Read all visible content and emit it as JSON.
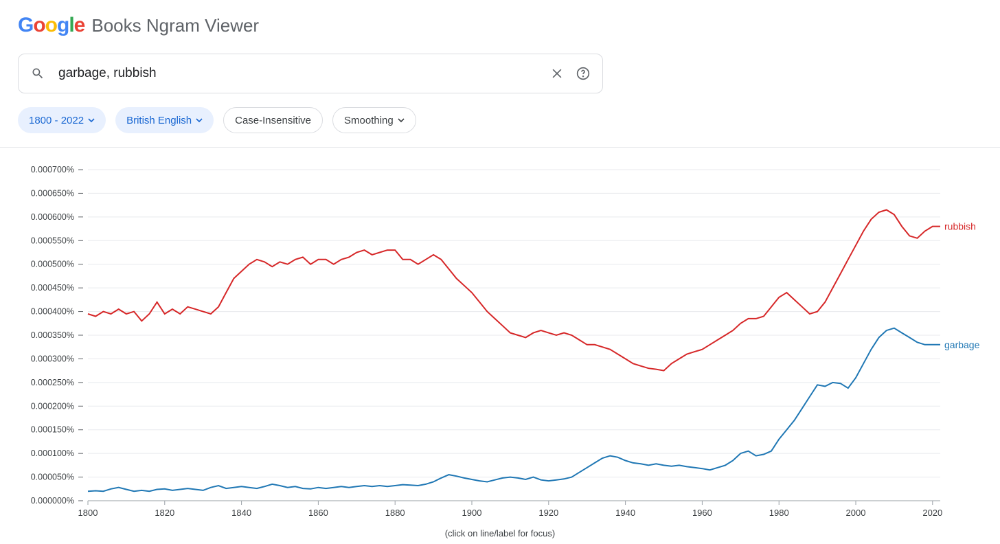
{
  "header": {
    "product_name": "Books Ngram Viewer"
  },
  "search": {
    "value": "garbage, rubbish"
  },
  "chips": {
    "year_range": "1800 - 2022",
    "corpus": "British English",
    "case": "Case-Insensitive",
    "smoothing": "Smoothing"
  },
  "caption": "(click on line/label for focus)",
  "chart_data": {
    "type": "line",
    "xlabel": "",
    "ylabel": "",
    "xlim": [
      1800,
      2022
    ],
    "ylim": [
      0,
      0.0007
    ],
    "y_ticks": [
      "0.000000%",
      "0.000050%",
      "0.000100%",
      "0.000150%",
      "0.000200%",
      "0.000250%",
      "0.000300%",
      "0.000350%",
      "0.000400%",
      "0.000450%",
      "0.000500%",
      "0.000550%",
      "0.000600%",
      "0.000650%",
      "0.000700%"
    ],
    "x_ticks": [
      1800,
      1820,
      1840,
      1860,
      1880,
      1900,
      1920,
      1940,
      1960,
      1980,
      2000,
      2020
    ],
    "series": [
      {
        "name": "rubbish",
        "color": "#d62728",
        "x": [
          1800,
          1802,
          1804,
          1806,
          1808,
          1810,
          1812,
          1814,
          1816,
          1818,
          1820,
          1822,
          1824,
          1826,
          1828,
          1830,
          1832,
          1834,
          1836,
          1838,
          1840,
          1842,
          1844,
          1846,
          1848,
          1850,
          1852,
          1854,
          1856,
          1858,
          1860,
          1862,
          1864,
          1866,
          1868,
          1870,
          1872,
          1874,
          1876,
          1878,
          1880,
          1882,
          1884,
          1886,
          1888,
          1890,
          1892,
          1894,
          1896,
          1898,
          1900,
          1902,
          1904,
          1906,
          1908,
          1910,
          1912,
          1914,
          1916,
          1918,
          1920,
          1922,
          1924,
          1926,
          1928,
          1930,
          1932,
          1934,
          1936,
          1938,
          1940,
          1942,
          1944,
          1946,
          1948,
          1950,
          1952,
          1954,
          1956,
          1958,
          1960,
          1962,
          1964,
          1966,
          1968,
          1970,
          1972,
          1974,
          1976,
          1978,
          1980,
          1982,
          1984,
          1986,
          1988,
          1990,
          1992,
          1994,
          1996,
          1998,
          2000,
          2002,
          2004,
          2006,
          2008,
          2010,
          2012,
          2014,
          2016,
          2018,
          2020,
          2022
        ],
        "values": [
          0.000395,
          0.00039,
          0.0004,
          0.000395,
          0.000405,
          0.000395,
          0.0004,
          0.00038,
          0.000395,
          0.00042,
          0.000395,
          0.000405,
          0.000395,
          0.00041,
          0.000405,
          0.0004,
          0.000395,
          0.00041,
          0.00044,
          0.00047,
          0.000485,
          0.0005,
          0.00051,
          0.000505,
          0.000495,
          0.000505,
          0.0005,
          0.00051,
          0.000515,
          0.0005,
          0.00051,
          0.00051,
          0.0005,
          0.00051,
          0.000515,
          0.000525,
          0.00053,
          0.00052,
          0.000525,
          0.00053,
          0.00053,
          0.00051,
          0.00051,
          0.0005,
          0.00051,
          0.00052,
          0.00051,
          0.00049,
          0.00047,
          0.000455,
          0.00044,
          0.00042,
          0.0004,
          0.000385,
          0.00037,
          0.000355,
          0.00035,
          0.000345,
          0.000355,
          0.00036,
          0.000355,
          0.00035,
          0.000355,
          0.00035,
          0.00034,
          0.00033,
          0.00033,
          0.000325,
          0.00032,
          0.00031,
          0.0003,
          0.00029,
          0.000285,
          0.00028,
          0.000278,
          0.000275,
          0.00029,
          0.0003,
          0.00031,
          0.000315,
          0.00032,
          0.00033,
          0.00034,
          0.00035,
          0.00036,
          0.000375,
          0.000385,
          0.000385,
          0.00039,
          0.00041,
          0.00043,
          0.00044,
          0.000425,
          0.00041,
          0.000395,
          0.0004,
          0.00042,
          0.00045,
          0.00048,
          0.00051,
          0.00054,
          0.00057,
          0.000595,
          0.00061,
          0.000615,
          0.000605,
          0.00058,
          0.00056,
          0.000555,
          0.00057,
          0.00058,
          0.00058
        ]
      },
      {
        "name": "garbage",
        "color": "#1f77b4",
        "x": [
          1800,
          1802,
          1804,
          1806,
          1808,
          1810,
          1812,
          1814,
          1816,
          1818,
          1820,
          1822,
          1824,
          1826,
          1828,
          1830,
          1832,
          1834,
          1836,
          1838,
          1840,
          1842,
          1844,
          1846,
          1848,
          1850,
          1852,
          1854,
          1856,
          1858,
          1860,
          1862,
          1864,
          1866,
          1868,
          1870,
          1872,
          1874,
          1876,
          1878,
          1880,
          1882,
          1884,
          1886,
          1888,
          1890,
          1892,
          1894,
          1896,
          1898,
          1900,
          1902,
          1904,
          1906,
          1908,
          1910,
          1912,
          1914,
          1916,
          1918,
          1920,
          1922,
          1924,
          1926,
          1928,
          1930,
          1932,
          1934,
          1936,
          1938,
          1940,
          1942,
          1944,
          1946,
          1948,
          1950,
          1952,
          1954,
          1956,
          1958,
          1960,
          1962,
          1964,
          1966,
          1968,
          1970,
          1972,
          1974,
          1976,
          1978,
          1980,
          1982,
          1984,
          1986,
          1988,
          1990,
          1992,
          1994,
          1996,
          1998,
          2000,
          2002,
          2004,
          2006,
          2008,
          2010,
          2012,
          2014,
          2016,
          2018,
          2020,
          2022
        ],
        "values": [
          2e-05,
          2.1e-05,
          2e-05,
          2.5e-05,
          2.8e-05,
          2.4e-05,
          2e-05,
          2.2e-05,
          2e-05,
          2.4e-05,
          2.5e-05,
          2.2e-05,
          2.4e-05,
          2.6e-05,
          2.4e-05,
          2.2e-05,
          2.8e-05,
          3.2e-05,
          2.6e-05,
          2.8e-05,
          3e-05,
          2.8e-05,
          2.6e-05,
          3e-05,
          3.5e-05,
          3.2e-05,
          2.8e-05,
          3e-05,
          2.6e-05,
          2.5e-05,
          2.8e-05,
          2.6e-05,
          2.8e-05,
          3e-05,
          2.8e-05,
          3e-05,
          3.2e-05,
          3e-05,
          3.2e-05,
          3e-05,
          3.2e-05,
          3.4e-05,
          3.3e-05,
          3.2e-05,
          3.5e-05,
          4e-05,
          4.8e-05,
          5.5e-05,
          5.2e-05,
          4.8e-05,
          4.5e-05,
          4.2e-05,
          4e-05,
          4.4e-05,
          4.8e-05,
          5e-05,
          4.8e-05,
          4.5e-05,
          5e-05,
          4.4e-05,
          4.2e-05,
          4.4e-05,
          4.6e-05,
          5e-05,
          6e-05,
          7e-05,
          8e-05,
          9e-05,
          9.5e-05,
          9.2e-05,
          8.5e-05,
          8e-05,
          7.8e-05,
          7.5e-05,
          7.8e-05,
          7.5e-05,
          7.3e-05,
          7.5e-05,
          7.2e-05,
          7e-05,
          6.8e-05,
          6.5e-05,
          7e-05,
          7.5e-05,
          8.5e-05,
          0.0001,
          0.000105,
          9.5e-05,
          9.8e-05,
          0.000105,
          0.00013,
          0.00015,
          0.00017,
          0.000195,
          0.00022,
          0.000245,
          0.000242,
          0.00025,
          0.000248,
          0.000238,
          0.00026,
          0.00029,
          0.00032,
          0.000345,
          0.00036,
          0.000365,
          0.000355,
          0.000345,
          0.000335,
          0.00033,
          0.00033,
          0.00033
        ]
      }
    ]
  }
}
